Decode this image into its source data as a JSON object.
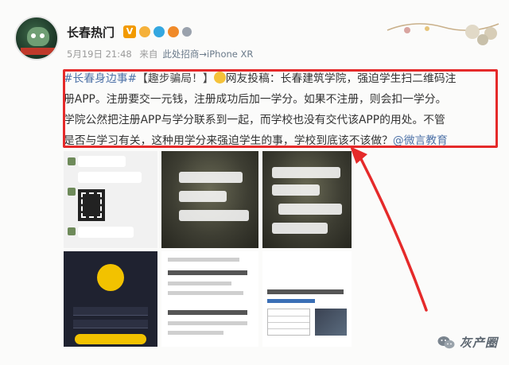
{
  "header": {
    "username": "长春热门",
    "vip_badge": "V",
    "time": "5月19日 21:48",
    "from_label": "来自",
    "device": "此处招商→iPhone XR"
  },
  "post": {
    "tag": "#长春身边事#",
    "bracket_title": "【趣步骗局！】",
    "line_intro": "网友投稿：长春建筑学院，强迫学生扫二维码注",
    "line2": "册APP。注册要交一元钱，注册成功后加一学分。如果不注册，则会扣一学分。",
    "line3": "学院公然把注册APP与学分联系到一起，而学校也没有交代该APP的用处。不管",
    "line4": "是否与学习有关，这种用学分来强迫学生的事，学校到底该不该做？",
    "mention": "@微言教育"
  },
  "colors": {
    "highlight_box": "#e52a2a",
    "link": "#4f73a8",
    "arrow": "#e52a2a"
  },
  "watermark": {
    "text": "灰产圈"
  }
}
